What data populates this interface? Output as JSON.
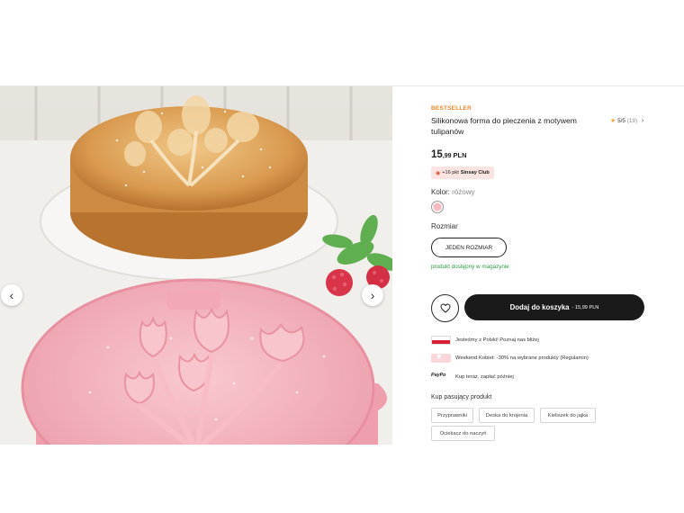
{
  "gallery": {
    "prev_icon": "chevron-left-icon",
    "next_icon": "chevron-right-icon"
  },
  "product": {
    "badge": "BESTSELLER",
    "title": "Silikonowa forma do pieczenia z motywem tulipanów",
    "rating": {
      "value": "5/5",
      "count": "(19)",
      "star_color": "#f0a23a"
    },
    "price": {
      "int": "15",
      "dec": ",99",
      "currency": "PLN"
    },
    "club": {
      "points": "+16 pkt",
      "name": "Sinsay Club"
    },
    "color": {
      "label": "Kolor:",
      "value": "różowy",
      "swatch_hex": "#f5b9c1"
    },
    "size": {
      "label": "Rozmiar",
      "option": "JEDEN ROZMIAR"
    },
    "stock": "produkt dostępny w magazynie",
    "cart": {
      "label": "Dodaj do koszyka",
      "price": "- 15,99 PLN"
    },
    "promos": [
      {
        "icon": "polish-flag-icon",
        "text": "Jesteśmy z Polski! Poznaj nas bliżej"
      },
      {
        "icon": "hearts-icon",
        "text": "Weekend Kobiet: -30% na wybrane produkty (Regulamin)"
      },
      {
        "icon": "paypo-logo",
        "logo": "PayPo",
        "text": "Kup teraz, zapłać później"
      }
    ],
    "matching": {
      "title": "Kup pasujący produkt",
      "chips": [
        "Przyprawniki",
        "Deska do krojenia",
        "Kieliszek do jajka",
        "Ociekacz do naczyń"
      ]
    }
  },
  "colors": {
    "accent_orange": "#e88a2b",
    "stock_green": "#2e9a47",
    "cart_bg": "#1a1a1a"
  }
}
